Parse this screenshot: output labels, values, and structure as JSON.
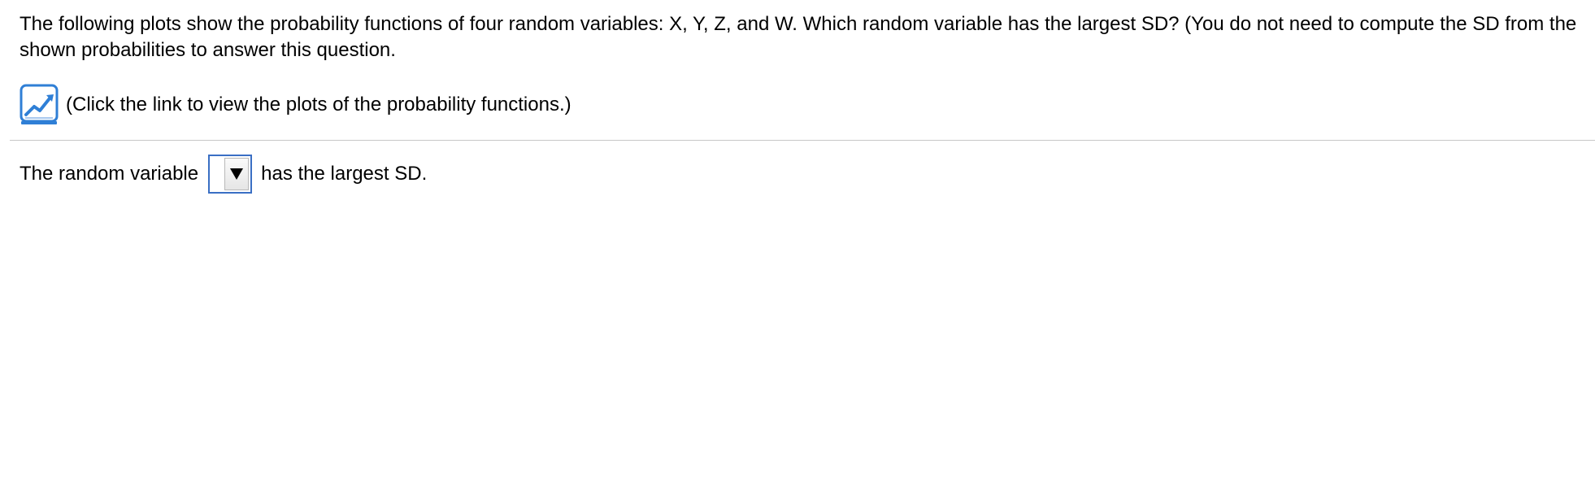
{
  "question": {
    "text": "The following plots show the probability functions of four random variables: X, Y, Z, and W. Which random variable has the largest SD? (You do not need to compute the SD from the shown probabilities to answer this question."
  },
  "link": {
    "icon": "chart-link-icon",
    "text": "(Click the link to view the plots of the probability functions.)"
  },
  "answer": {
    "prefix": "The random variable",
    "selected_value": "",
    "suffix": "has the largest SD."
  },
  "colors": {
    "icon_blue": "#2f7fd6",
    "select_border": "#3a6fc4",
    "divider": "#c8c8c8"
  }
}
